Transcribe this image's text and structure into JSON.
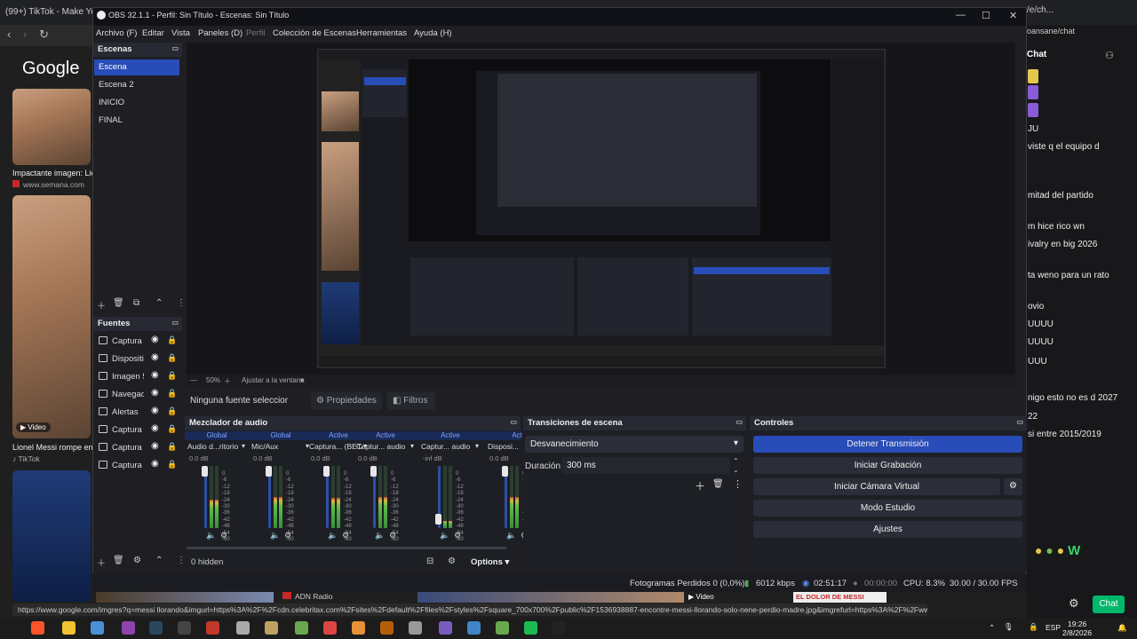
{
  "browser": {
    "tab_title": "(99+) TikTok - Make Yo",
    "right_tab": "/e/ch...",
    "google": "Google",
    "results": [
      {
        "caption": "Impactante imagen: Lio",
        "source": "www.semana.com"
      },
      {
        "caption": "Lionel Messi rompe en",
        "source": "TikTok",
        "badge": "Video"
      }
    ],
    "bottom_strip": [
      {
        "label": "ADN Radio"
      },
      {
        "label": "Video"
      },
      {
        "label": "EL DOLOR DE MESSI"
      }
    ],
    "status_url": "https://www.google.com/imgres?q=messi llorando&imgurl=https%3A%2F%2Fcdn.celebritax.com%2Fsites%2Fdefault%2Ffiles%2Fstyles%2Fsquare_700x700%2Fpublic%2F1536938887-encontre-messi-llorando-solo-nene-perdio-madre.jpg&imgrefurl=https%3A%2F%2Fwww.cibercuba.c..."
  },
  "chat": {
    "header_user": "oansane/chat",
    "title": "Chat",
    "messages": [
      "JU",
      "viste q el equipo d",
      "mitad del partido",
      "m hice rico wn",
      "ivalry en big 2026",
      "ta weno para un rato",
      "ovio",
      "UUUU",
      "UUUU",
      "UUU",
      "nigo esto no es d 2027",
      "22",
      "si entre 2015/2019"
    ],
    "chat_button": "Chat"
  },
  "obs": {
    "title": "OBS 32.1.1 - Perfil: Sin Título - Escenas: Sin Título",
    "menu": [
      "Archivo (F)",
      "Editar",
      "Vista",
      "Paneles (D)",
      "Perfil",
      "Colección de Escenas",
      "Herramientas",
      "Ayuda (H)"
    ],
    "scenes": {
      "title": "Escenas",
      "items": [
        "Escena",
        "Escena 2",
        "INICIO",
        "FINAL"
      ],
      "active_index": 0
    },
    "sources": {
      "title": "Fuentes",
      "items": [
        "Captura d",
        "Dispositiv",
        "Imagen 5",
        "Navegado",
        "Alertas",
        "Captura d",
        "Captura d",
        "Captura d"
      ]
    },
    "preview": {
      "zoom": "50%",
      "fit": "Ajustar a la ventana",
      "no_source": "Ninguna fuente seleccionad",
      "properties": "Propiedades",
      "filters": "Filtros"
    },
    "mixer": {
      "title": "Mezclador de audio",
      "channels": [
        {
          "head": "Global",
          "name": "Audio d...ritorio",
          "db": "0.0 dB",
          "level": 0.45
        },
        {
          "head": "Global",
          "name": "Mic/Aux",
          "db": "0.0 dB",
          "level": 0.5
        },
        {
          "head": "Active",
          "name": "Captura... (BETA)",
          "db": "0.0 dB",
          "level": 0.48
        },
        {
          "head": "Active",
          "name": "Captur... audio",
          "db": "0.0 dB",
          "level": 0.5
        },
        {
          "head": "Active",
          "name": "Captur... audio",
          "db": "-inf dB",
          "level": 0.12
        },
        {
          "head": "Act",
          "name": "Disposi...",
          "db": "0.0 dB",
          "level": 0.5
        }
      ],
      "scale": [
        "0",
        "-6",
        "-12",
        "-18",
        "-24",
        "-30",
        "-36",
        "-42",
        "-48",
        "-54",
        "-60"
      ],
      "hidden": "0 hidden",
      "options": "Options"
    },
    "transitions": {
      "title": "Transiciones de escena",
      "selected": "Desvanecimiento",
      "duration_label": "Duración",
      "duration_value": "300 ms"
    },
    "controls": {
      "title": "Controles",
      "buttons": [
        "Detener Transmisión",
        "Iniciar Grabación",
        "Iniciar Cámara Virtual",
        "Modo Estudio",
        "Ajustes"
      ]
    },
    "status": {
      "dropped": "Fotogramas Perdidos 0 (0,0%)",
      "bitrate": "6012 kbps",
      "live_time": "02:51:17",
      "rec_time": "00:00:00",
      "cpu": "CPU: 8.3%",
      "fps": "30.00 / 30.00 FPS"
    }
  },
  "taskbar": {
    "lang": "ESP",
    "time": "19:26",
    "date": "2/8/2026"
  },
  "colors": {
    "accent": "#284cb8",
    "twitch_green": "#00b86b"
  }
}
